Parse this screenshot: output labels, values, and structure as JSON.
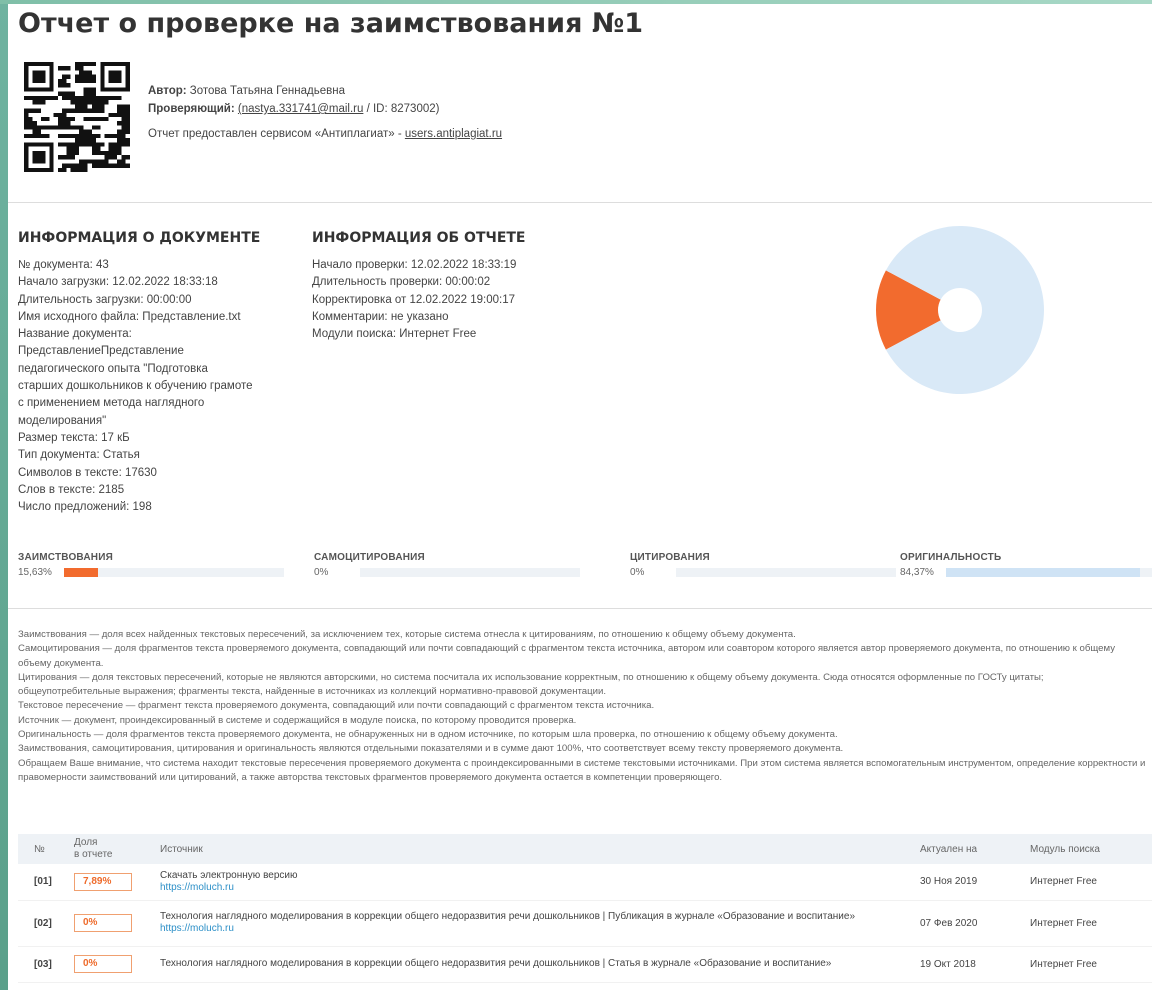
{
  "title": "Отчет о проверке на заимствования №1",
  "author": {
    "author_label": "Автор:",
    "author_value": "Зотова Татьяна Геннадьевна",
    "checker_label": "Проверяющий:",
    "checker_email": "(nastya.331741@mail.ru",
    "checker_id": " / ID: 8273002)",
    "service_text": "Отчет предоставлен сервисом «Антиплагиат» - ",
    "service_link": "users.antiplagiat.ru"
  },
  "doc_info": {
    "heading": "ИНФОРМАЦИЯ О ДОКУМЕНТЕ",
    "lines": [
      "№ документа: 43",
      "Начало загрузки: 12.02.2022 18:33:18",
      "Длительность загрузки: 00:00:00",
      "Имя исходного файла: Представление.txt",
      "Название документа:",
      "ПредставлениеПредставление",
      "педагогического опыта \"Подготовка",
      "старших дошкольников к обучению грамоте",
      "с применением метода наглядного",
      "моделирования\"",
      "Размер текста: 17 кБ",
      "Тип документа: Статья",
      "Символов в тексте: 17630",
      "Слов в тексте: 2185",
      "Число предложений: 198"
    ]
  },
  "report_info": {
    "heading": "ИНФОРМАЦИЯ ОБ ОТЧЕТЕ",
    "lines": [
      "Начало проверки: 12.02.2022 18:33:19",
      "Длительность проверки: 00:00:02",
      "Корректировка от 12.02.2022 19:00:17",
      "Комментарии: не указано",
      "Модули поиска: Интернет Free"
    ]
  },
  "colors": {
    "borrow": "#f26b2e",
    "original": "#d9e9f7",
    "track": "#eef2f6"
  },
  "chart_data": {
    "type": "pie",
    "categories": [
      "ЗАИМСТВОВАНИЯ",
      "САМОЦИТИРОВАНИЯ",
      "ЦИТИРОВАНИЯ",
      "ОРИГИНАЛЬНОСТЬ"
    ],
    "values": [
      15.63,
      0,
      0,
      84.37
    ]
  },
  "metrics": [
    {
      "label": "ЗАИМСТВОВАНИЯ",
      "value_text": "15,63%",
      "value": 15.63,
      "color": "#f26b2e"
    },
    {
      "label": "САМОЦИТИРОВАНИЯ",
      "value_text": "0%",
      "value": 0,
      "color": "#f6a25e"
    },
    {
      "label": "ЦИТИРОВАНИЯ",
      "value_text": "0%",
      "value": 0,
      "color": "#58c08a"
    },
    {
      "label": "ОРИГИНАЛЬНОСТЬ",
      "value_text": "84,37%",
      "value": 84.37,
      "color": "#cfe3f5"
    }
  ],
  "definitions": [
    "Заимствования — доля всех найденных текстовых пересечений, за исключением тех, которые система отнесла к цитированиям, по отношению к общему объему документа.",
    "Самоцитирования — доля фрагментов текста проверяемого документа, совпадающий или почти совпадающий с фрагментом текста источника, автором или соавтором которого является автор проверяемого документа, по отношению к общему объему документа.",
    "Цитирования — доля текстовых пересечений, которые не являются авторскими, но система посчитала их использование корректным, по отношению к общему объему документа. Сюда относятся оформленные по ГОСТу цитаты; общеупотребительные выражения; фрагменты текста, найденные в источниках из коллекций нормативно-правовой документации.",
    "Текстовое пересечение — фрагмент текста проверяемого документа, совпадающий или почти совпадающий с фрагментом текста источника.",
    "Источник — документ, проиндексированный в системе и содержащийся в модуле поиска, по которому проводится проверка.",
    "Оригинальность — доля фрагментов текста проверяемого документа, не обнаруженных ни в одном источнике, по которым шла проверка, по отношению к общему объему документа.",
    "Заимствования, самоцитирования, цитирования и оригинальность являются отдельными показателями и в сумме дают 100%, что соответствует всему тексту проверяемого документа.",
    "Обращаем Ваше внимание, что система находит текстовые пересечения проверяемого документа с проиндексированными в системе текстовыми источниками. При этом система является вспомогательным инструментом, определение корректности и правомерности заимствований или цитирований, а также авторства текстовых фрагментов проверяемого документа остается в компетенции проверяющего."
  ],
  "table": {
    "headers": {
      "num": "№",
      "share_1": "Доля",
      "share_2": "в отчете",
      "source": "Источник",
      "date": "Актуален на",
      "module": "Модуль поиска"
    },
    "rows": [
      {
        "num": "[01]",
        "share": "7,89%",
        "title": "Скачать электронную версию",
        "url": "https://moluch.ru",
        "date": "30 Ноя 2019",
        "module": "Интернет Free"
      },
      {
        "num": "[02]",
        "share": "0%",
        "title": "Технология наглядного моделирования в коррекции общего недоразвития речи дошкольников | Публикация в журнале «Образование и воспитание»",
        "url": "https://moluch.ru",
        "date": "07 Фев 2020",
        "module": "Интернет Free"
      },
      {
        "num": "[03]",
        "share": "0%",
        "title": "Технология наглядного моделирования в коррекции общего недоразвития речи дошкольников | Статья в журнале «Образование и воспитание»",
        "url": "",
        "date": "19 Окт 2018",
        "module": "Интернет Free"
      }
    ]
  }
}
